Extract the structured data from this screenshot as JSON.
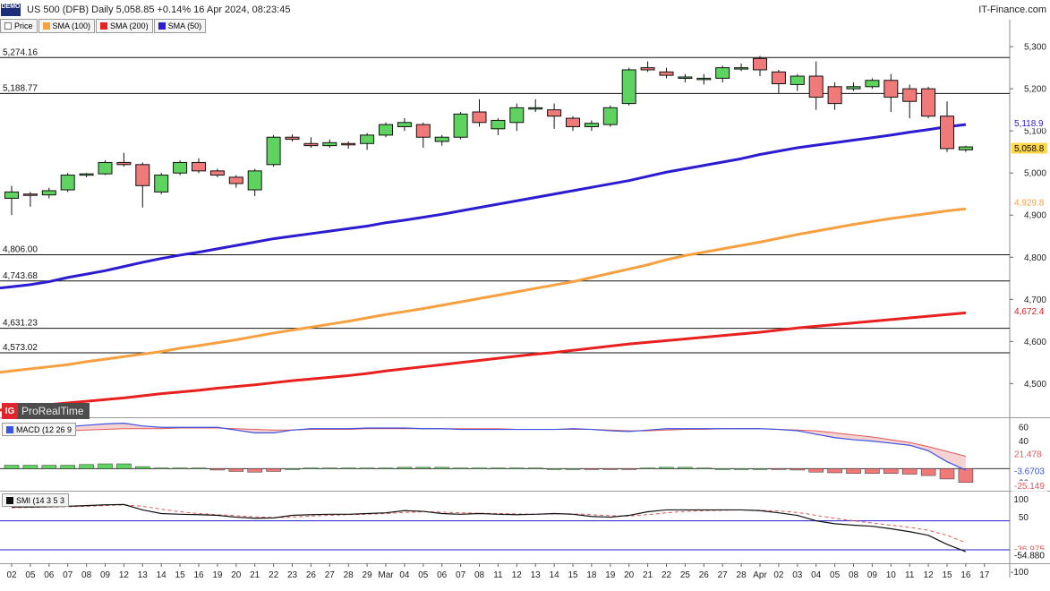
{
  "header": {
    "badge": "DEMO",
    "title": "US 500 (DFB) Daily 5,058.85 +0.14% 16 Apr 2024, 08:23:45",
    "source": "IT-Finance.com"
  },
  "legend": [
    {
      "label": "Price",
      "color": "#ffffff"
    },
    {
      "label": "SMA (100)",
      "color": "#f7a040"
    },
    {
      "label": "SMA (200)",
      "color": "#e8211f"
    },
    {
      "label": "SMA (50)",
      "color": "#2c1bd1"
    }
  ],
  "logo": {
    "mark": "IG",
    "text": "ProRealTime"
  },
  "colors": {
    "up": "#5fd35f",
    "down": "#f07a7a",
    "sma50": "#2c1bd1",
    "sma100": "#f7a040",
    "sma200": "#e8211f",
    "macd": "#3c52e0",
    "signal": "#e05a5a",
    "smi": "#111111"
  },
  "chart_data": [
    {
      "type": "candlestick",
      "name": "price",
      "ylim": [
        4420,
        5330
      ],
      "yticks": [
        4500,
        4600,
        4700,
        4800,
        4900,
        5000,
        5100,
        5200,
        5300
      ],
      "ytick_labels": [
        "4,500",
        "4,600",
        "4,700",
        "4,800",
        "4,900",
        "5,000",
        "5,100",
        "5,200",
        "5,300"
      ],
      "x_labels": [
        "02",
        "05",
        "06",
        "07",
        "08",
        "09",
        "12",
        "13",
        "14",
        "15",
        "16",
        "19",
        "20",
        "21",
        "22",
        "23",
        "26",
        "27",
        "28",
        "29",
        "Mar",
        "04",
        "05",
        "06",
        "07",
        "08",
        "11",
        "12",
        "13",
        "14",
        "15",
        "18",
        "19",
        "20",
        "21",
        "22",
        "25",
        "26",
        "27",
        "28",
        "Apr",
        "02",
        "03",
        "04",
        "05",
        "08",
        "09",
        "10",
        "11",
        "12",
        "15",
        "16",
        "17"
      ],
      "ohlc": [
        [
          4940,
          4970,
          4900,
          4955
        ],
        [
          4950,
          4955,
          4920,
          4948
        ],
        [
          4948,
          4965,
          4940,
          4958
        ],
        [
          4960,
          5000,
          4955,
          4995
        ],
        [
          4995,
          5000,
          4990,
          4998
        ],
        [
          4998,
          5030,
          4995,
          5025
        ],
        [
          5025,
          5048,
          5015,
          5020
        ],
        [
          5020,
          5025,
          4918,
          4970
        ],
        [
          4955,
          5000,
          4950,
          4995
        ],
        [
          5000,
          5030,
          4995,
          5025
        ],
        [
          5025,
          5035,
          5000,
          5005
        ],
        [
          5005,
          5010,
          4990,
          4995
        ],
        [
          4990,
          4995,
          4965,
          4975
        ],
        [
          4960,
          5010,
          4945,
          5005
        ],
        [
          5020,
          5090,
          5015,
          5085
        ],
        [
          5085,
          5092,
          5075,
          5080
        ],
        [
          5070,
          5085,
          5060,
          5065
        ],
        [
          5065,
          5080,
          5060,
          5072
        ],
        [
          5070,
          5075,
          5058,
          5068
        ],
        [
          5070,
          5095,
          5055,
          5090
        ],
        [
          5090,
          5120,
          5085,
          5115
        ],
        [
          5110,
          5130,
          5100,
          5120
        ],
        [
          5115,
          5120,
          5060,
          5085
        ],
        [
          5075,
          5090,
          5065,
          5085
        ],
        [
          5085,
          5145,
          5080,
          5140
        ],
        [
          5145,
          5175,
          5110,
          5120
        ],
        [
          5105,
          5130,
          5090,
          5125
        ],
        [
          5120,
          5165,
          5100,
          5155
        ],
        [
          5155,
          5175,
          5145,
          5155
        ],
        [
          5150,
          5165,
          5105,
          5135
        ],
        [
          5130,
          5135,
          5100,
          5110
        ],
        [
          5110,
          5125,
          5100,
          5118
        ],
        [
          5115,
          5160,
          5110,
          5155
        ],
        [
          5165,
          5250,
          5160,
          5245
        ],
        [
          5250,
          5265,
          5240,
          5245
        ],
        [
          5240,
          5250,
          5225,
          5232
        ],
        [
          5225,
          5235,
          5215,
          5228
        ],
        [
          5222,
          5235,
          5210,
          5225
        ],
        [
          5225,
          5255,
          5215,
          5250
        ],
        [
          5250,
          5260,
          5242,
          5250
        ],
        [
          5272,
          5278,
          5230,
          5245
        ],
        [
          5240,
          5245,
          5190,
          5212
        ],
        [
          5210,
          5235,
          5195,
          5230
        ],
        [
          5230,
          5265,
          5150,
          5180
        ],
        [
          5205,
          5215,
          5150,
          5165
        ],
        [
          5200,
          5215,
          5195,
          5205
        ],
        [
          5205,
          5225,
          5200,
          5220
        ],
        [
          5220,
          5235,
          5145,
          5180
        ],
        [
          5200,
          5210,
          5130,
          5170
        ],
        [
          5200,
          5205,
          5130,
          5135
        ],
        [
          5135,
          5170,
          5050,
          5058
        ],
        [
          5055,
          5065,
          5050,
          5062
        ]
      ],
      "sma50": [
        4730,
        4735,
        4742,
        4752,
        4760,
        4768,
        4778,
        4788,
        4797,
        4805,
        4812,
        4820,
        4828,
        4836,
        4844,
        4850,
        4856,
        4862,
        4868,
        4874,
        4882,
        4888,
        4895,
        4902,
        4910,
        4918,
        4926,
        4934,
        4942,
        4950,
        4958,
        4966,
        4974,
        4982,
        4992,
        5002,
        5010,
        5018,
        5026,
        5034,
        5044,
        5052,
        5060,
        5066,
        5072,
        5078,
        5084,
        5090,
        5097,
        5103,
        5110,
        5115
      ],
      "sma100": [
        4530,
        4535,
        4540,
        4545,
        4552,
        4558,
        4564,
        4570,
        4576,
        4584,
        4590,
        4597,
        4604,
        4612,
        4620,
        4627,
        4634,
        4641,
        4648,
        4656,
        4664,
        4671,
        4678,
        4686,
        4694,
        4702,
        4710,
        4718,
        4726,
        4734,
        4742,
        4752,
        4762,
        4772,
        4782,
        4794,
        4804,
        4812,
        4820,
        4828,
        4836,
        4845,
        4854,
        4862,
        4870,
        4878,
        4885,
        4892,
        4898,
        4904,
        4910,
        4915
      ],
      "sma200": [
        4440,
        4445,
        4450,
        4454,
        4458,
        4462,
        4466,
        4471,
        4476,
        4480,
        4484,
        4489,
        4493,
        4497,
        4502,
        4507,
        4511,
        4515,
        4519,
        4524,
        4530,
        4535,
        4540,
        4545,
        4550,
        4555,
        4560,
        4565,
        4570,
        4574,
        4579,
        4584,
        4589,
        4594,
        4598,
        4602,
        4606,
        4610,
        4614,
        4618,
        4622,
        4627,
        4632,
        4636,
        4640,
        4644,
        4648,
        4652,
        4656,
        4660,
        4664,
        4668
      ],
      "levels": [
        {
          "value": 5274.16,
          "label": "5,274.16"
        },
        {
          "value": 5188.77,
          "label": "5,188.77"
        },
        {
          "value": 4806.0,
          "label": "4,806.00"
        },
        {
          "value": 4743.68,
          "label": "4,743.68"
        },
        {
          "value": 4631.23,
          "label": "4,631.23"
        },
        {
          "value": 4573.02,
          "label": "4,573.02"
        }
      ],
      "right_tags": [
        {
          "value": 5118.9,
          "label": "5,118.9",
          "color": "#2c1bd1"
        },
        {
          "value": 5058.8,
          "label": "5,058.8",
          "color": "#000000",
          "bg": "#ffd84a"
        },
        {
          "value": 4929.8,
          "label": "4,929.8",
          "color": "#f7a040"
        },
        {
          "value": 4672.4,
          "label": "4,672.4",
          "color": "#e8211f"
        }
      ]
    },
    {
      "type": "line+bar",
      "name": "MACD (12 26 9",
      "ylim": [
        -32,
        72
      ],
      "yticks": [
        60,
        40,
        20,
        -20
      ],
      "ytick_labels": [
        "60",
        "40",
        "20",
        "-20"
      ],
      "macd": [
        58,
        59,
        60,
        61,
        63,
        65,
        66,
        62,
        60,
        60,
        60,
        60,
        56,
        52,
        52,
        56,
        58,
        58,
        58,
        59,
        59,
        59,
        58,
        58,
        57,
        57,
        57,
        57,
        57,
        57,
        58,
        57,
        55,
        54,
        56,
        58,
        58,
        58,
        58,
        58,
        58,
        57,
        55,
        50,
        45,
        42,
        40,
        37,
        34,
        26,
        10,
        -2
      ],
      "signal": [
        52,
        53,
        54,
        55,
        56,
        57,
        58,
        58,
        58,
        59,
        59,
        59,
        58,
        57,
        56,
        56,
        57,
        57,
        57,
        58,
        58,
        58,
        58,
        58,
        58,
        58,
        58,
        57,
        57,
        57,
        57,
        57,
        56,
        55,
        55,
        56,
        57,
        57,
        58,
        58,
        58,
        57,
        56,
        55,
        52,
        49,
        46,
        42,
        38,
        32,
        25,
        18
      ],
      "hist": [
        5,
        5,
        5,
        5,
        6,
        7,
        7,
        3,
        1,
        1,
        1,
        -2,
        -4,
        -5,
        -4,
        0,
        1,
        1,
        1,
        1,
        1,
        2,
        2,
        2,
        1,
        1,
        1,
        1,
        1,
        0,
        0,
        -1,
        -1,
        -1,
        1,
        2,
        2,
        1,
        0,
        0,
        0,
        -1,
        -2,
        -5,
        -6,
        -7,
        -7,
        -7,
        -8,
        -10,
        -15,
        -20
      ],
      "right_tags": [
        {
          "value": 21.478,
          "label": "21.478",
          "color": "#e05a5a"
        },
        {
          "value": -3.6703,
          "label": "-3.6703",
          "color": "#3c52e0"
        },
        {
          "value": -25.149,
          "label": "-25.149",
          "color": "#e05a5a"
        }
      ]
    },
    {
      "type": "line",
      "name": "SMI (14 3 5 3",
      "ylim": [
        -72,
        118
      ],
      "yticks": [
        100,
        50,
        -50,
        -100
      ],
      "ytick_labels": [
        "100",
        "50",
        "-50",
        "-100"
      ],
      "hlines": [
        40,
        -40
      ],
      "smi": [
        78,
        78,
        79,
        80,
        82,
        84,
        85,
        70,
        60,
        58,
        57,
        55,
        50,
        47,
        48,
        55,
        57,
        58,
        58,
        60,
        62,
        68,
        66,
        60,
        58,
        60,
        58,
        57,
        58,
        60,
        58,
        52,
        50,
        55,
        65,
        70,
        70,
        70,
        70,
        70,
        68,
        62,
        55,
        40,
        32,
        28,
        25,
        18,
        10,
        0,
        -25,
        -45
      ],
      "signal": [
        76,
        77,
        78,
        79,
        80,
        82,
        84,
        80,
        72,
        65,
        60,
        57,
        54,
        51,
        49,
        50,
        53,
        55,
        57,
        58,
        60,
        63,
        65,
        64,
        62,
        61,
        60,
        59,
        58,
        59,
        59,
        57,
        54,
        53,
        57,
        62,
        66,
        68,
        69,
        70,
        69,
        67,
        63,
        55,
        47,
        40,
        34,
        28,
        22,
        14,
        0,
        -20
      ],
      "right_tags": [
        {
          "value": -36.975,
          "label": "-36.975",
          "color": "#e05a5a"
        },
        {
          "value": -54.88,
          "label": "-54.880",
          "color": "#111111"
        }
      ]
    }
  ]
}
